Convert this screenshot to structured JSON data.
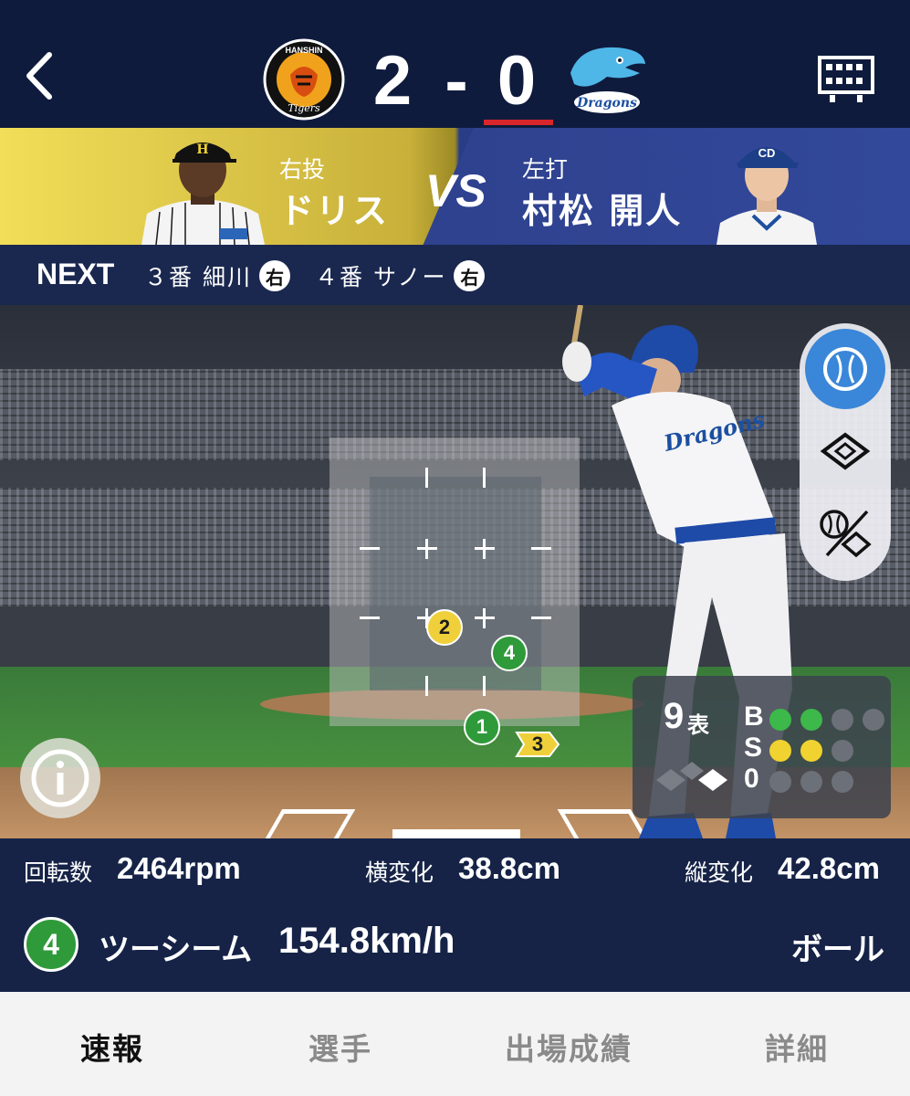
{
  "header": {
    "home_team_logo_text": "HANSHIN Tigers",
    "away_team_logo_text": "Dragons",
    "home_score": "2",
    "dash": "-",
    "away_score": "0"
  },
  "matchup": {
    "pitcher_role": "右投",
    "pitcher_name": "ドリス",
    "vs": "VS",
    "batter_role": "左打",
    "batter_name": "村松 開人"
  },
  "next": {
    "label": "NEXT",
    "items": [
      {
        "order": "３番 細川",
        "hand": "右"
      },
      {
        "order": "４番 サノー",
        "hand": "右"
      }
    ]
  },
  "pitches": [
    {
      "num": "2",
      "color": "yellow"
    },
    {
      "num": "4",
      "color": "green"
    },
    {
      "num": "1",
      "color": "green"
    },
    {
      "num": "3",
      "color": "yellow"
    }
  ],
  "count": {
    "inning": "9",
    "half": "表",
    "b_label": "B",
    "s_label": "S",
    "o_label": "0",
    "balls": 2,
    "strikes": 2,
    "outs": 0
  },
  "stats": {
    "spin_label": "回転数",
    "spin_value": "2464rpm",
    "hbreak_label": "横変化",
    "hbreak_value": "38.8cm",
    "vbreak_label": "縦変化",
    "vbreak_value": "42.8cm"
  },
  "pitch": {
    "number": "4",
    "type": "ツーシーム",
    "speed": "154.8km/h",
    "result": "ボール"
  },
  "tabs": [
    {
      "label": "速報",
      "active": true
    },
    {
      "label": "選手",
      "active": false
    },
    {
      "label": "出場成績",
      "active": false
    },
    {
      "label": "詳細",
      "active": false
    }
  ],
  "colors": {
    "header_bg": "#0f1b3d",
    "accent_red": "#d8262b",
    "ball_green": "#3db84a",
    "strike_yellow": "#f0d230",
    "active_view_blue": "#3a86d8"
  }
}
